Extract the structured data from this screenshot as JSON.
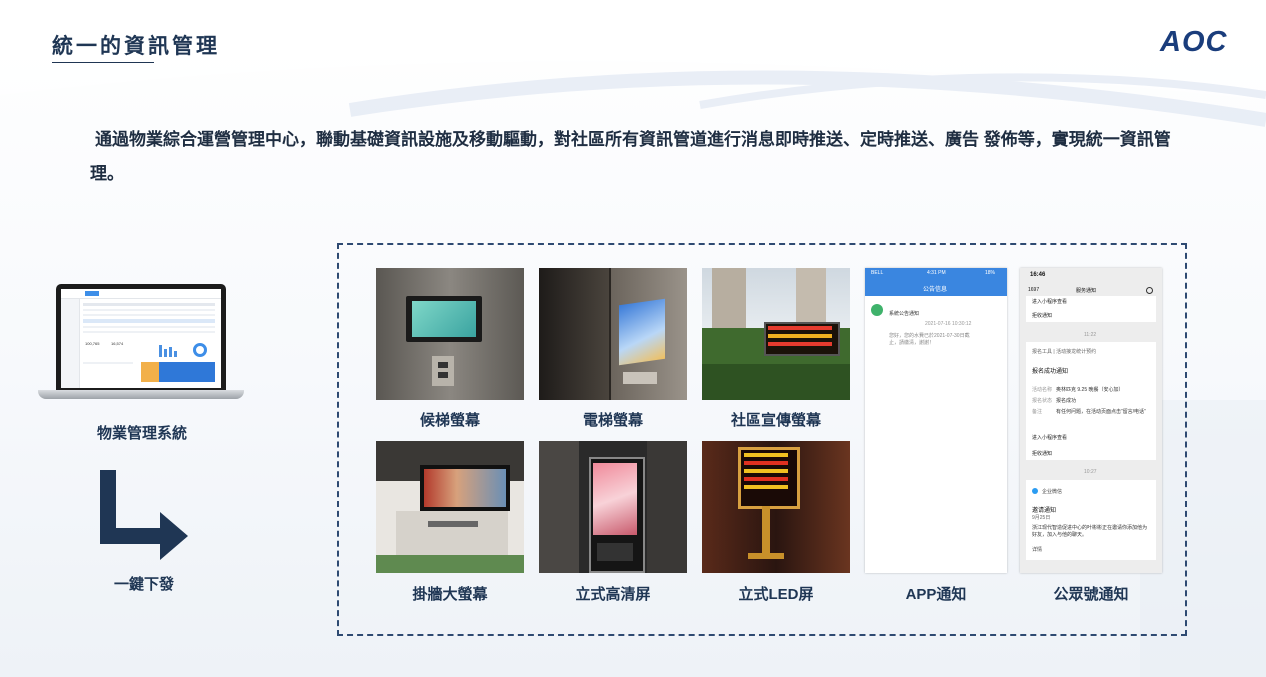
{
  "header": {
    "title": "統一的資訊管理",
    "logo_text": "AOC"
  },
  "intro": {
    "text": "通過物業綜合運營管理中心，聯動基礎資訊設施及移動驅動，對社區所有資訊管道進行消息即時推送、定時推送、廣告 發佈等，實現統一資訊管理。"
  },
  "left": {
    "system_label": "物業管理系統",
    "action_label": "一鍵下發"
  },
  "channels": [
    {
      "label": "候梯螢幕"
    },
    {
      "label": "電梯螢幕"
    },
    {
      "label": "社區宣傳螢幕"
    },
    {
      "label": "APP通知"
    },
    {
      "label": "公眾號通知"
    },
    {
      "label": "掛牆大螢幕"
    },
    {
      "label": "立式高清屏"
    },
    {
      "label": "立式LED屏"
    }
  ],
  "app_screen": {
    "carrier": "BELL",
    "time": "4:31 PM",
    "battery": "18%",
    "header": "公告信息",
    "notice_title": "系統公告通知",
    "notice_date": "2021-07-16 10:30:12",
    "notice_body": "您好，您的水費已於2021-07-30日截止，請繳清，謝謝！"
  },
  "wechat_screen": {
    "time": "16:46",
    "back_count": "1697",
    "header": "服务通知",
    "item_enter": "进入小程序查看",
    "item_refuse": "拒收通知",
    "time1": "11:22",
    "app_name": "报名工具 | 活动接龙统计预约",
    "success_title": "报名成功通知",
    "row1_key": "活动名称",
    "row1_val": "奥林匹克 9.25 晚餐（安心加）",
    "row2_key": "报名状态",
    "row2_val": "报名成功",
    "row3_key": "备注",
    "row3_val": "有任何问题，在活动页面点击“留言/电话”",
    "time2": "10:27",
    "work_app": "企业微信",
    "invite_title": "邀请通知",
    "invite_date": "9月25日",
    "invite_body": "浙江现代智造促进中心的叶彬彬正在邀请你添加他为好友，加入与他的聊天。",
    "detail": "详情"
  },
  "dashboard": {
    "stat1": "100,765",
    "stat2": "16,574"
  },
  "colors": {
    "title": "#1f3654",
    "logo": "#1a3d7c",
    "frame": "#2e4a72"
  }
}
